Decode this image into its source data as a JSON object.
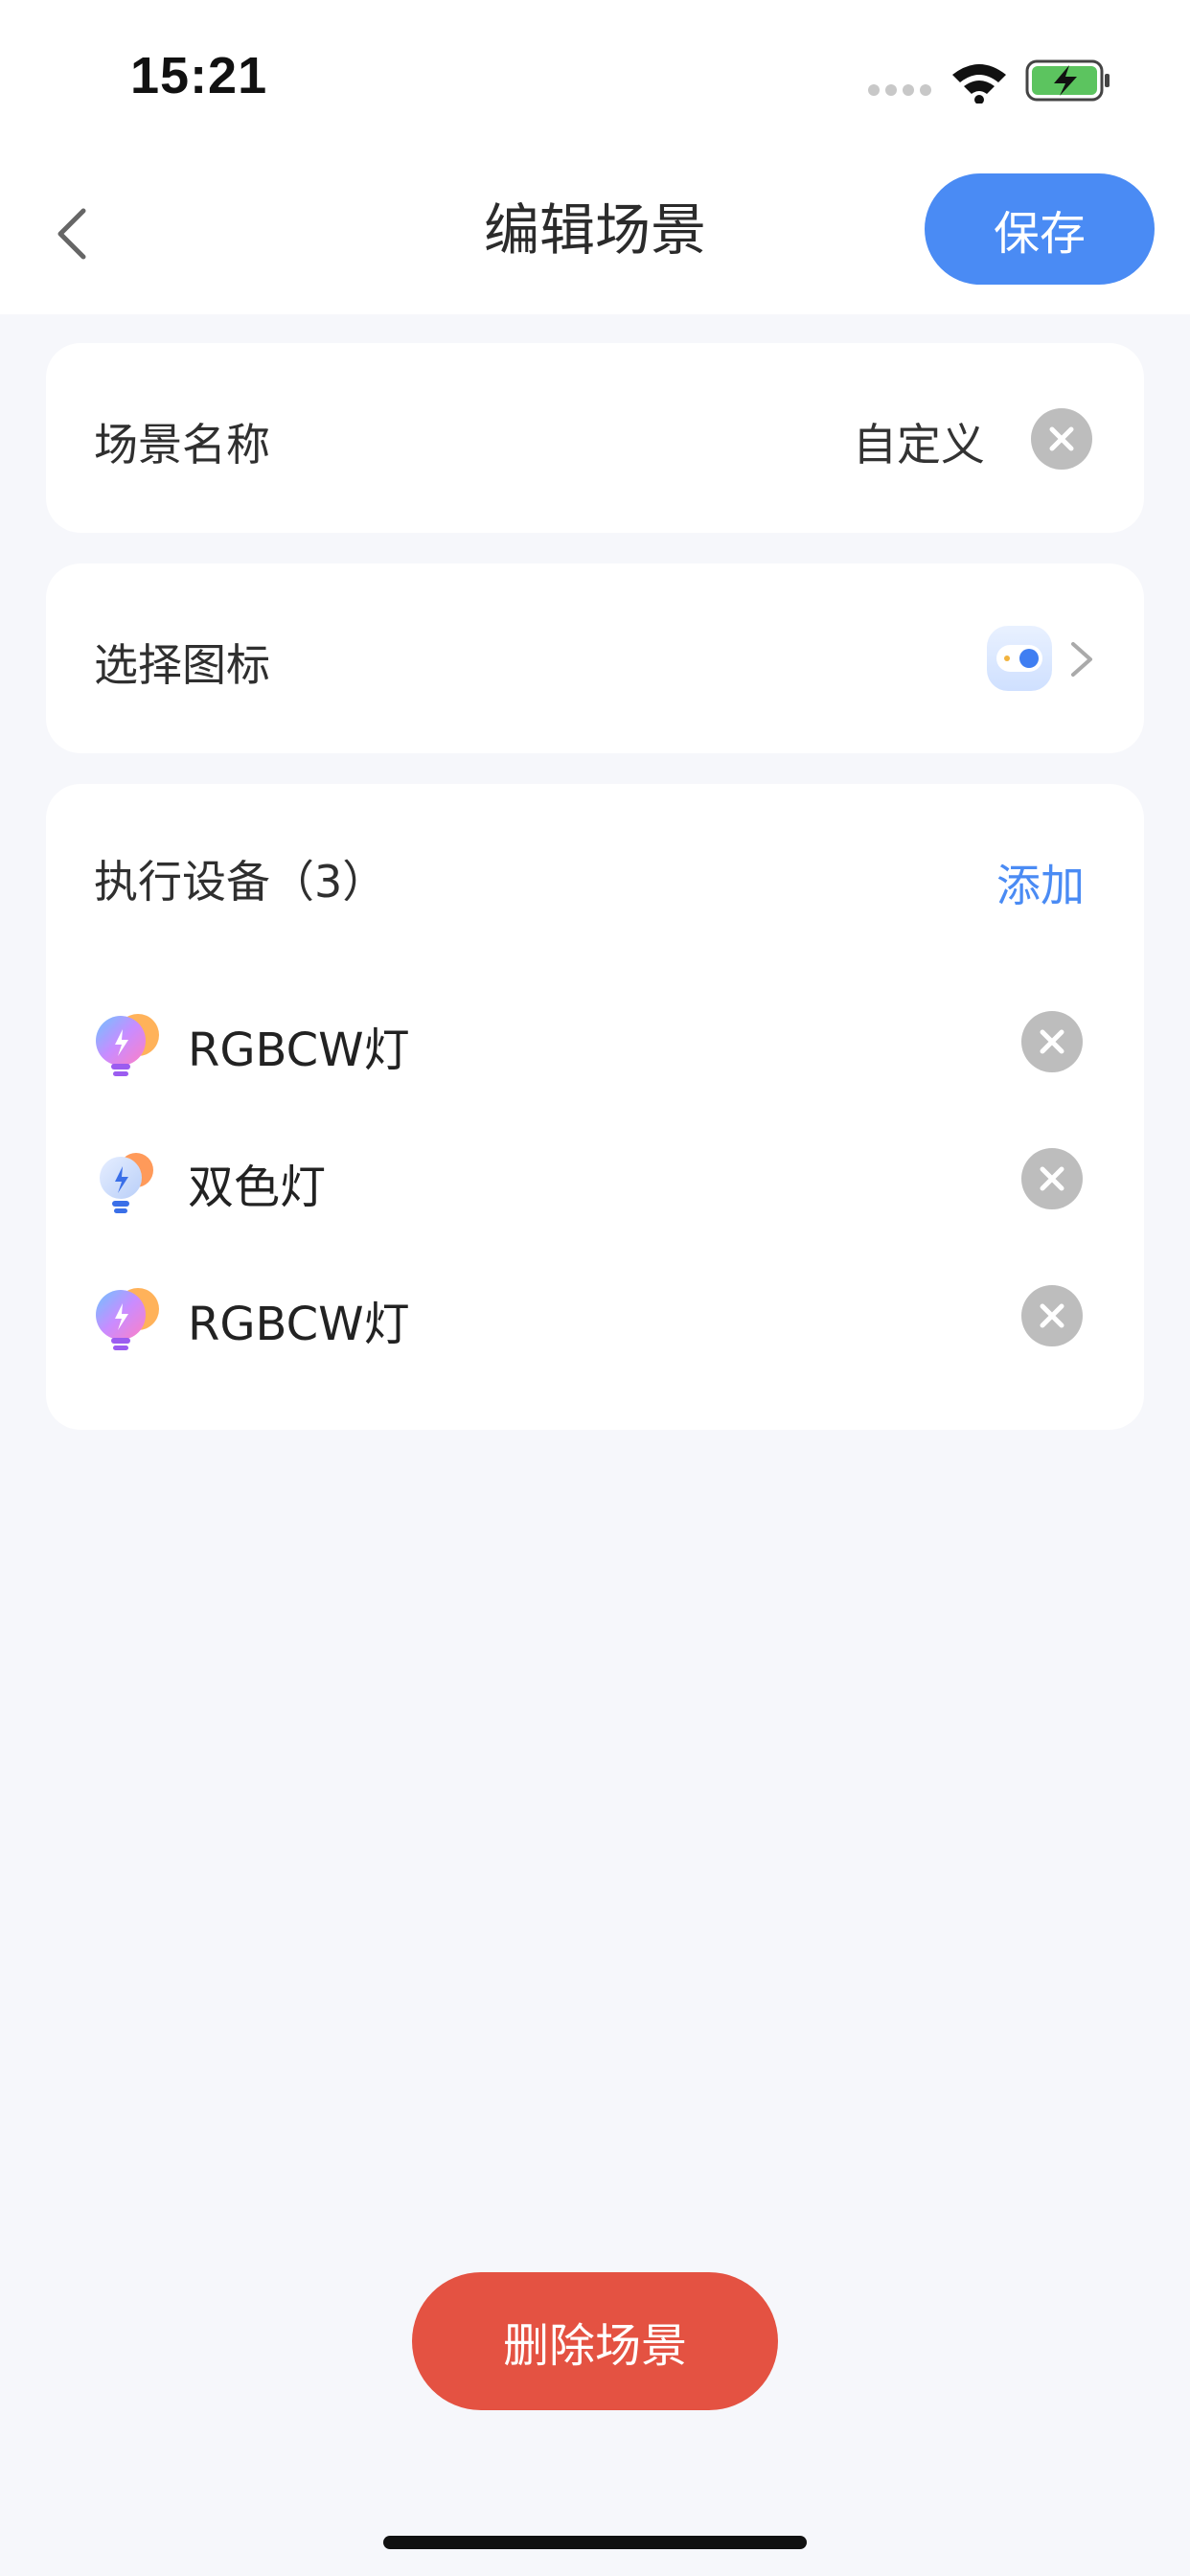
{
  "status_bar": {
    "time": "15:21"
  },
  "nav": {
    "title": "编辑场景",
    "save_label": "保存"
  },
  "scene_name": {
    "label": "场景名称",
    "value": "自定义"
  },
  "icon_select": {
    "label": "选择图标"
  },
  "devices": {
    "title": "执行设备（3）",
    "add_label": "添加",
    "items": [
      {
        "name": "RGBCW灯",
        "icon": "rgbcw-bulb-icon"
      },
      {
        "name": "双色灯",
        "icon": "dual-color-bulb-icon"
      },
      {
        "name": "RGBCW灯",
        "icon": "rgbcw-bulb-icon"
      }
    ]
  },
  "footer": {
    "delete_label": "删除场景"
  },
  "colors": {
    "accent": "#4a8bf4",
    "danger": "#e45242",
    "background": "#f6f7fb",
    "clear_button": "#bdbdbd"
  }
}
